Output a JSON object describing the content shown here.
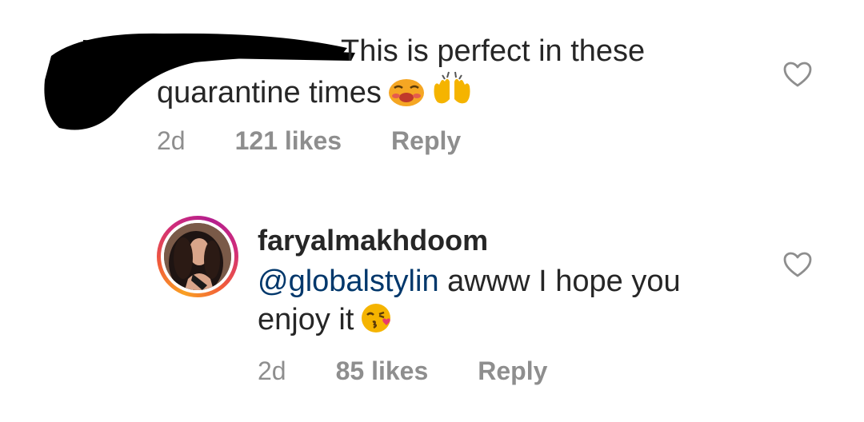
{
  "comment1": {
    "text_line1": "This is perfect in these",
    "text_line2": "quarantine times",
    "emojis": [
      "weary-face-emoji",
      "raising-hands-emoji"
    ],
    "time": "2d",
    "likes": "121 likes",
    "reply": "Reply"
  },
  "comment2": {
    "username": "faryalmakhdoom",
    "mention": "@globalstylin",
    "text_after_mention": " awww I hope you",
    "text_line2": "enjoy it",
    "emojis": [
      "face-blowing-kiss-emoji"
    ],
    "time": "2d",
    "likes": "85 likes",
    "reply": "Reply"
  },
  "icons": {
    "like": "heart-outline-icon"
  },
  "colors": {
    "text": "#262626",
    "meta": "#8e8e8e",
    "mention": "#00376b",
    "background": "#ffffff"
  }
}
